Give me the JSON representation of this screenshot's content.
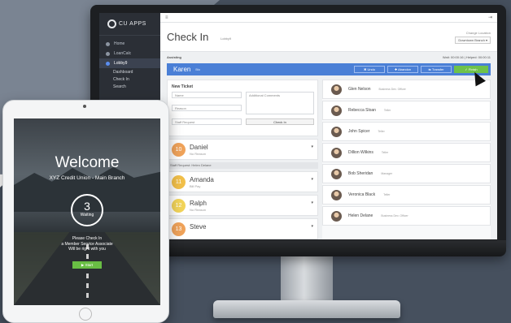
{
  "app": {
    "brand": "CU APPS",
    "page_title": "Check In",
    "page_subtitle": "Lobby9"
  },
  "topbar": {
    "menu_icon": "hamburger-icon",
    "right_icon": "logout-icon",
    "right_glyph": "⇥"
  },
  "sidebar": {
    "items": [
      {
        "label": "Home",
        "icon": "home-icon"
      },
      {
        "label": "LoanCalc",
        "icon": "calculator-icon"
      },
      {
        "label": "Lobby9",
        "icon": "lobby-icon",
        "active": true
      }
    ],
    "sub_items": [
      "Dashboard",
      "Check In",
      "Search"
    ]
  },
  "branch": {
    "label": "Change Location",
    "value": "Downtown Branch ▾"
  },
  "assisting": {
    "label": "Assisting",
    "timing": "Wait: 00:00:16 | Helped: 00:00:11"
  },
  "current": {
    "name": "Karen",
    "tag": "Bio",
    "buttons": [
      "✖ Undo",
      "✚ Abandon",
      "⇆ Transfer"
    ],
    "finish": "✓ Finish"
  },
  "ticket": {
    "title": "New Ticket",
    "name_placeholder": "Name",
    "reason_placeholder": "Reason",
    "staff_placeholder": "Staff Request",
    "comments_placeholder": "Additional Comments",
    "checkin_label": "Check In"
  },
  "queue": [
    {
      "number": "10",
      "name": "Daniel",
      "reason": "No Reason",
      "color": "#f0a35a"
    },
    {
      "number": "11",
      "name": "Amanda",
      "reason": "Bill Pay",
      "color": "#f2c04a"
    },
    {
      "number": "12",
      "name": "Ralph",
      "reason": "No Reason",
      "color": "#f2d45a"
    },
    {
      "number": "13",
      "name": "Steve",
      "reason": "",
      "color": "#f0a35a"
    }
  ],
  "queue_separator": "Staff Request: Helen Delane",
  "users": [
    {
      "name": "Glen Nelson",
      "role": "Business Dev. Officer"
    },
    {
      "name": "Rebecca Sloan",
      "role": "Teller"
    },
    {
      "name": "John Spicer",
      "role": "Teller"
    },
    {
      "name": "Dillion Wilkins",
      "role": "Teller"
    },
    {
      "name": "Bob Sheridan",
      "role": "Manager"
    },
    {
      "name": "Veronica Black",
      "role": "Teller"
    },
    {
      "name": "Helen Delane",
      "role": "Business Dev. Officer"
    }
  ],
  "ipad": {
    "welcome": "Welcome",
    "branch": "XYZ Credit Union - Main Branch",
    "waiting_count": "3",
    "waiting_label": "Waiting",
    "message_1": "Please Check In",
    "message_2": "a Member Service Associate",
    "message_3": "Will be right with you",
    "start_label": "▶ Start"
  }
}
